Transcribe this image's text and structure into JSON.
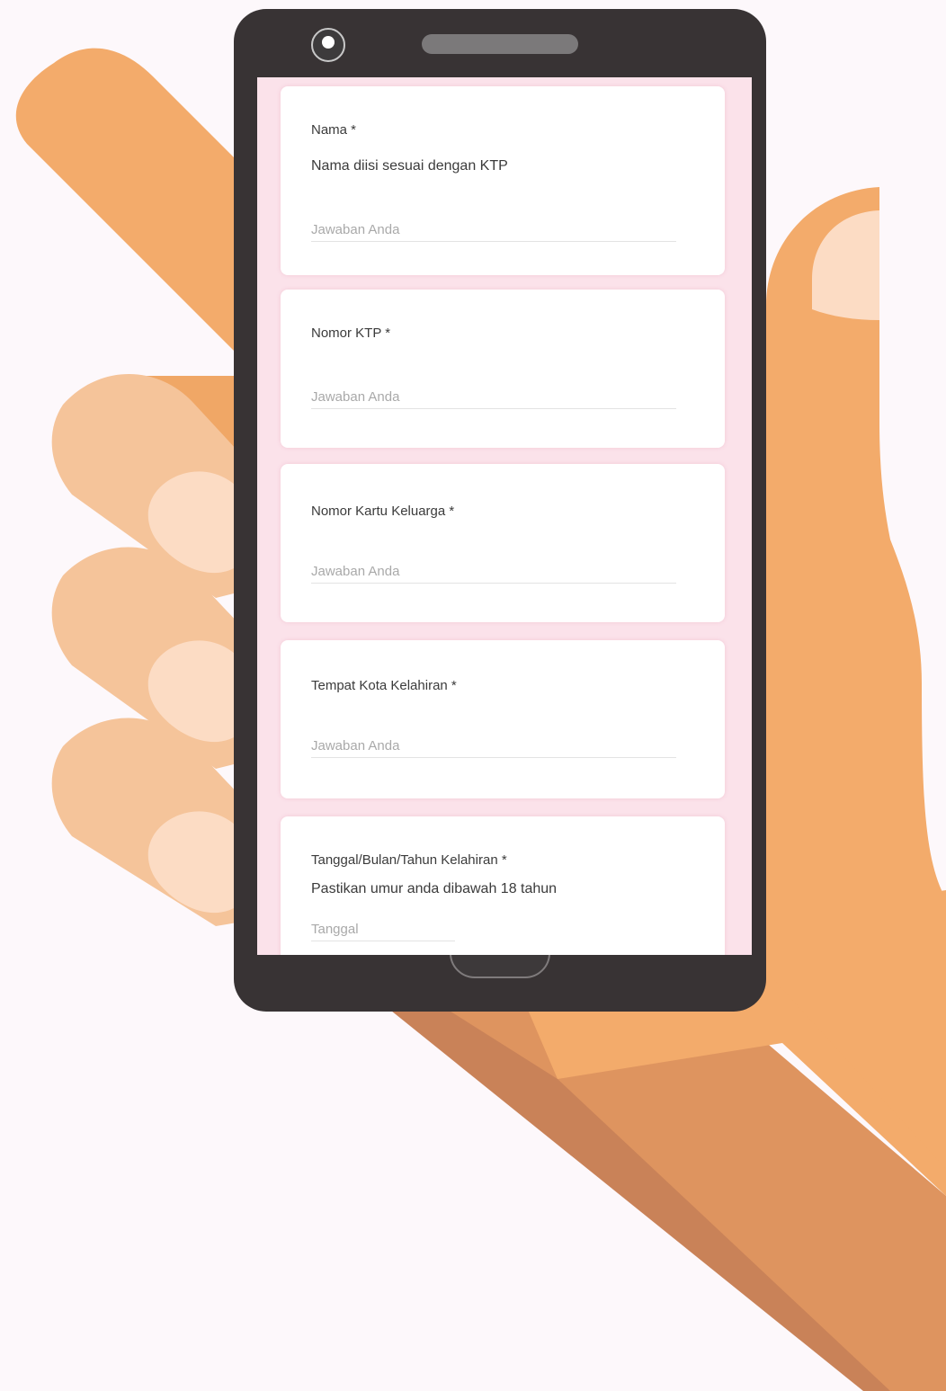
{
  "form": {
    "answer_placeholder": "Jawaban Anda",
    "date_placeholder": "Tanggal",
    "questions": [
      {
        "label": "Nama *",
        "description": "Nama diisi sesuai dengan KTP"
      },
      {
        "label": "Nomor KTP *"
      },
      {
        "label": "Nomor Kartu Keluarga *"
      },
      {
        "label": "Tempat Kota Kelahiran *"
      },
      {
        "label": "Tanggal/Bulan/Tahun Kelahiran *",
        "description": "Pastikan umur anda dibawah 18 tahun"
      }
    ]
  },
  "colors": {
    "background": "#fdf8fb",
    "hand": "#f3ab6b",
    "hand_shadow": "#de945f",
    "finger_light": "#f5c49a",
    "nail": "#fcdcc4",
    "phone_body": "#383334",
    "screen_bg": "#fbe2ea"
  }
}
